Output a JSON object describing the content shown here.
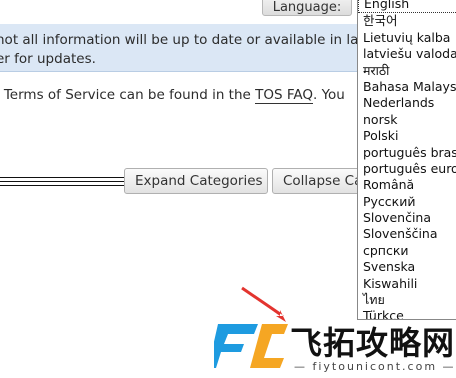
{
  "header": {
    "language_button": "Language:"
  },
  "notice": {
    "line1": "not all information will be up to date or available in la",
    "line2": "er for updates."
  },
  "tos": {
    "before": "r Terms of Service can be found in the ",
    "link": "TOS FAQ",
    "after": ". You"
  },
  "categories": {
    "expand_label": "Expand Categories",
    "collapse_label": "Collapse Ca"
  },
  "language_list": {
    "items": [
      "English",
      "한국어",
      "Lietuvių kalba",
      "latviešu valoda",
      "मराठी",
      "Bahasa Malaysia",
      "Nederlands",
      "norsk",
      "Polski",
      "português brasil",
      "português europ",
      "Română",
      "Русский",
      "Slovenčina",
      "Slovenščina",
      "српски",
      "Svenska",
      "Kiswahili",
      "ไทย",
      "Türkçe"
    ],
    "selected": "English"
  },
  "watermark": {
    "text": "飞拓攻略网",
    "subtext": "— fiytounicont.com —"
  },
  "colors": {
    "notice_bg": "#dbe7f5",
    "arrow": "#e3342f",
    "logo_blue": "#1e9be0"
  }
}
